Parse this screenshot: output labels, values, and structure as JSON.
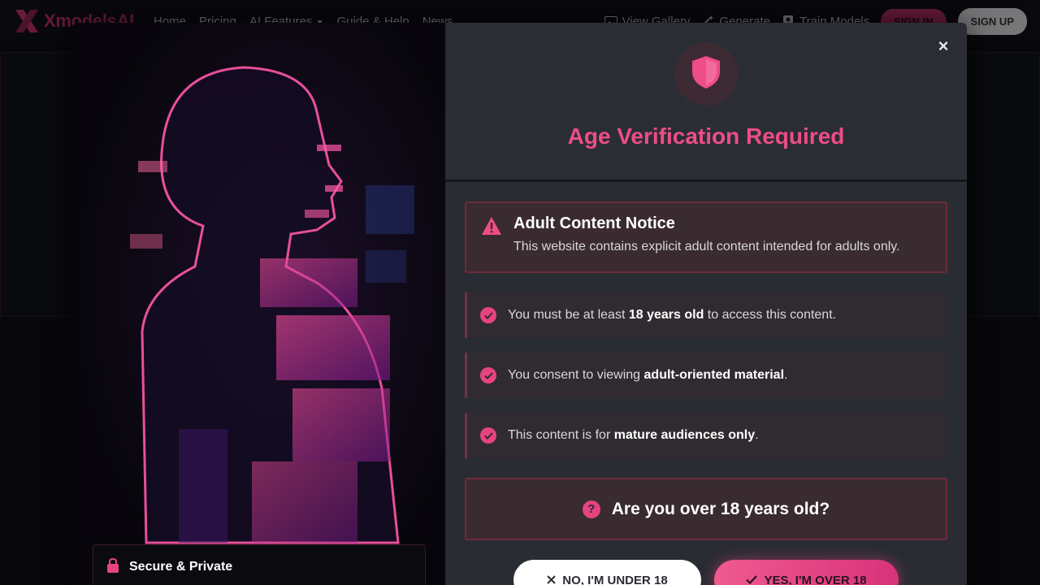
{
  "nav": {
    "brand": "XmodelsAI",
    "links": [
      "Home",
      "Pricing",
      "AI Features",
      "Guide & Help",
      "News"
    ],
    "actions": [
      {
        "label": "View Gallery",
        "icon": "image-icon"
      },
      {
        "label": "Generate",
        "icon": "magic-wand-icon"
      },
      {
        "label": "Train Models",
        "icon": "user-icon"
      }
    ],
    "sign_in": "SIGN IN",
    "sign_up": "SIGN UP"
  },
  "modal": {
    "title": "Age Verification Required",
    "close_label": "×",
    "notice": {
      "title": "Adult Content Notice",
      "text": "This website contains explicit adult content intended for adults only."
    },
    "requirements": [
      {
        "before": "You must be at least ",
        "bold": "18 years old",
        "after": " to access this content."
      },
      {
        "before": "You consent to viewing ",
        "bold": "adult-oriented material",
        "after": "."
      },
      {
        "before": "This content is for ",
        "bold": "mature audiences only",
        "after": "."
      }
    ],
    "question": "Are you over 18 years old?",
    "question_icon_char": "?",
    "no_button": "NO, I'M UNDER 18",
    "yes_button": "YES, I'M OVER 18",
    "secure_label": "Secure & Private"
  },
  "colors": {
    "accent": "#ee4d86",
    "brand": "#c2306d",
    "panel": "#2a2c33"
  }
}
